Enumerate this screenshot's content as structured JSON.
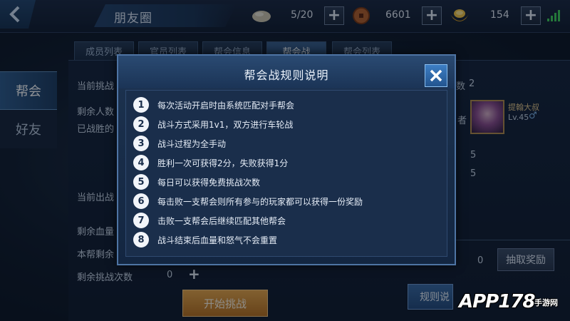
{
  "header": {
    "title": "朋友圈",
    "resources": [
      {
        "icon": "stone-icon",
        "value": "5/20"
      },
      {
        "icon": "coin-icon",
        "value": "6601"
      },
      {
        "icon": "gold-ingot-icon",
        "value": "154"
      }
    ]
  },
  "sidebar": {
    "items": [
      {
        "label": "帮会",
        "active": true
      },
      {
        "label": "好友",
        "active": false
      }
    ]
  },
  "tabs": [
    {
      "label": "成员列表"
    },
    {
      "label": "官员列表"
    },
    {
      "label": "帮会信息"
    },
    {
      "label": "帮会战",
      "active": true
    },
    {
      "label": "帮会列表"
    }
  ],
  "background": {
    "current_challenge_label": "当前挑战",
    "remaining_people_label": "剩余人数",
    "defeated_label": "已战胜的",
    "current_fighter_label": "当前出战",
    "remaining_hp_label": "剩余血量",
    "guild_remaining_label": "本帮剩余",
    "remaining_attempts_label": "剩余挑战次数",
    "remaining_attempts_value": "0",
    "right_count_label": "数",
    "right_count_value": "2",
    "leader_suffix": "者",
    "player_name": "提翰大叔",
    "player_level": "Lv.45",
    "stat_a": "5",
    "stat_b": "5",
    "reward_count": "0",
    "draw_reward_label": "抽取奖励",
    "start_challenge_label": "开始挑战",
    "rules_button_label": "规则说"
  },
  "modal": {
    "title": "帮会战规则说明",
    "rules": [
      {
        "num": "1",
        "text": "每次活动开启时由系统匹配对手帮会"
      },
      {
        "num": "2",
        "text": "战斗方式采用1v1，双方进行车轮战"
      },
      {
        "num": "3",
        "text": "战斗过程为全手动"
      },
      {
        "num": "4",
        "text": "胜利一次可获得2分，失败获得1分"
      },
      {
        "num": "5",
        "text": "每日可以获得免费挑战次数"
      },
      {
        "num": "6",
        "text": "每击败一支帮会则所有参与的玩家都可以获得一份奖励"
      },
      {
        "num": "7",
        "text": "击败一支帮会后继续匹配其他帮会"
      },
      {
        "num": "8",
        "text": "战斗结束后血量和怒气不会重置"
      }
    ]
  },
  "watermark": {
    "text": "APP178",
    "sub": "手游网"
  },
  "colors": {
    "accent": "#4e74a4",
    "start_button": "#e8a648",
    "signal": "#3ecf5a"
  }
}
